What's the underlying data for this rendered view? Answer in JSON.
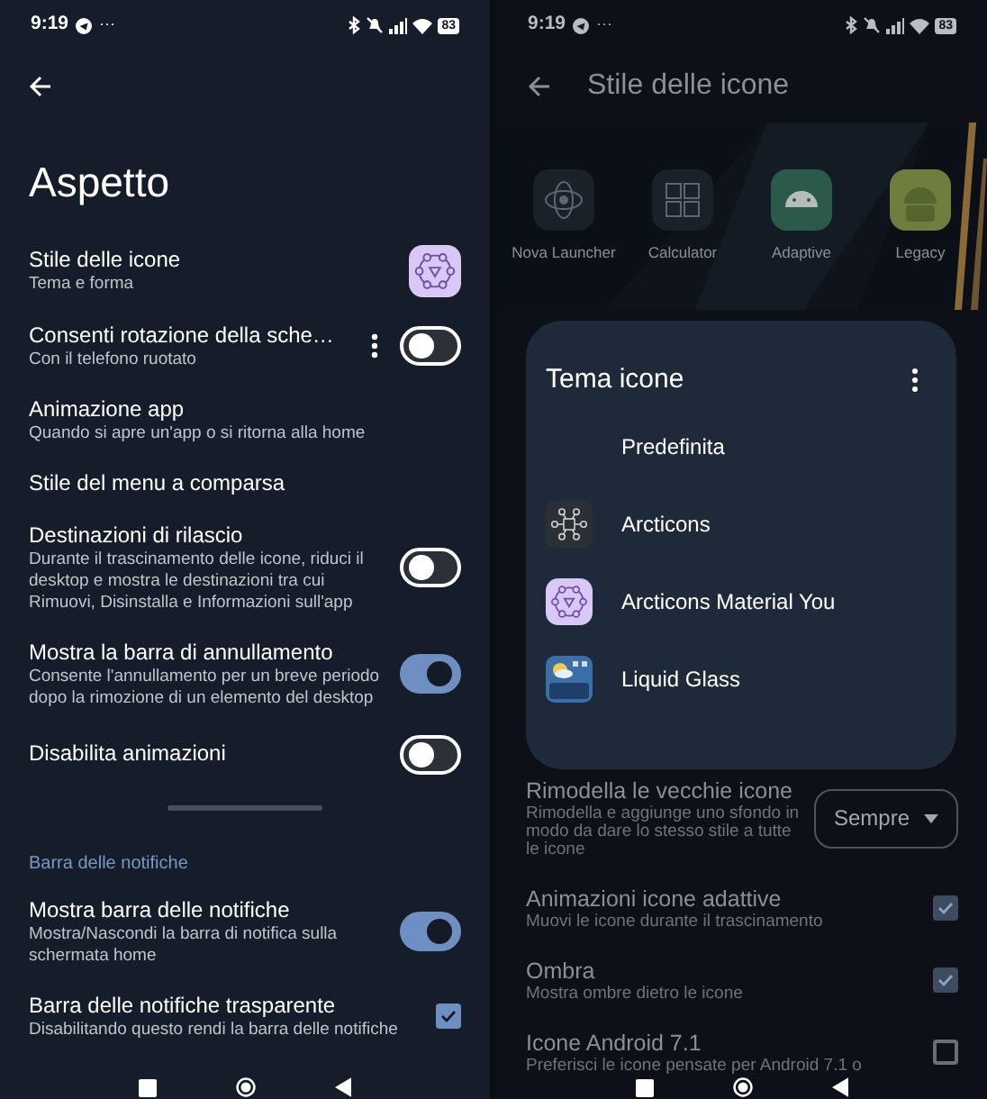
{
  "left": {
    "status_bar": {
      "time": "9:19",
      "more": "···",
      "battery": "83"
    },
    "title": "Aspetto",
    "items": [
      {
        "kind": "icon",
        "title": "Stile delle icone",
        "subtitle": "Tema e forma"
      },
      {
        "kind": "toggle",
        "title": "Consenti rotazione della sche…",
        "subtitle": "Con il telefono ruotato",
        "on": false,
        "has_menu": true
      },
      {
        "kind": "plain",
        "title": "Animazione app",
        "subtitle": "Quando si apre un'app o si ritorna alla home"
      },
      {
        "kind": "plain",
        "title": "Stile del menu a comparsa"
      },
      {
        "kind": "toggle",
        "title": "Destinazioni di rilascio",
        "subtitle": "Durante il trascinamento delle icone, riduci il desktop e mostra le destinazioni tra cui Rimuovi, Disinstalla e Informazioni sull'app",
        "on": false,
        "has_menu": false
      },
      {
        "kind": "toggle",
        "title": "Mostra la barra di annullamento",
        "subtitle": "Consente l'annullamento per un breve periodo dopo la rimozione di un elemento del desktop",
        "on": true,
        "has_menu": false
      },
      {
        "kind": "toggle",
        "title": "Disabilita animazioni",
        "on": false,
        "has_menu": false
      },
      {
        "kind": "section",
        "title": "Barra delle notifiche"
      },
      {
        "kind": "toggle",
        "title": "Mostra barra delle notifiche",
        "subtitle": "Mostra/Nascondi la barra di notifica sulla schermata home",
        "on": true,
        "has_menu": false
      },
      {
        "kind": "checkbox",
        "title": "Barra delle notifiche trasparente",
        "subtitle": "Disabilitando questo rendi la barra delle notifiche",
        "checked": true
      }
    ]
  },
  "right": {
    "status_bar": {
      "time": "9:19",
      "more": "···",
      "battery": "83"
    },
    "title": "Stile delle icone",
    "previews": [
      {
        "label": "Nova Launcher",
        "kind": "nova"
      },
      {
        "label": "Calculator",
        "kind": "calc"
      },
      {
        "label": "Adaptive",
        "kind": "adaptive"
      },
      {
        "label": "Legacy",
        "kind": "legacy"
      }
    ],
    "dialog": {
      "title": "Tema icone",
      "options": [
        {
          "label": "Predefinita",
          "kind": "none"
        },
        {
          "label": "Arcticons",
          "kind": "dark"
        },
        {
          "label": "Arcticons Material You",
          "kind": "light"
        },
        {
          "label": "Liquid Glass",
          "kind": "glass"
        }
      ]
    },
    "items": [
      {
        "kind": "dropdown",
        "title": "Rimodella le vecchie icone",
        "subtitle": "Rimodella e aggiunge uno sfondo in modo da dare lo stesso stile a tutte le icone",
        "value": "Sempre"
      },
      {
        "kind": "checkbox",
        "title": "Animazioni icone adattive",
        "subtitle": "Muovi le icone durante il trascinamento",
        "checked": true
      },
      {
        "kind": "checkbox",
        "title": "Ombra",
        "subtitle": "Mostra ombre dietro le icone",
        "checked": true
      },
      {
        "kind": "checkbox",
        "title": "Icone Android 7.1",
        "subtitle": "Preferisci le icone pensate per Android 7.1 o",
        "checked": false
      }
    ]
  }
}
